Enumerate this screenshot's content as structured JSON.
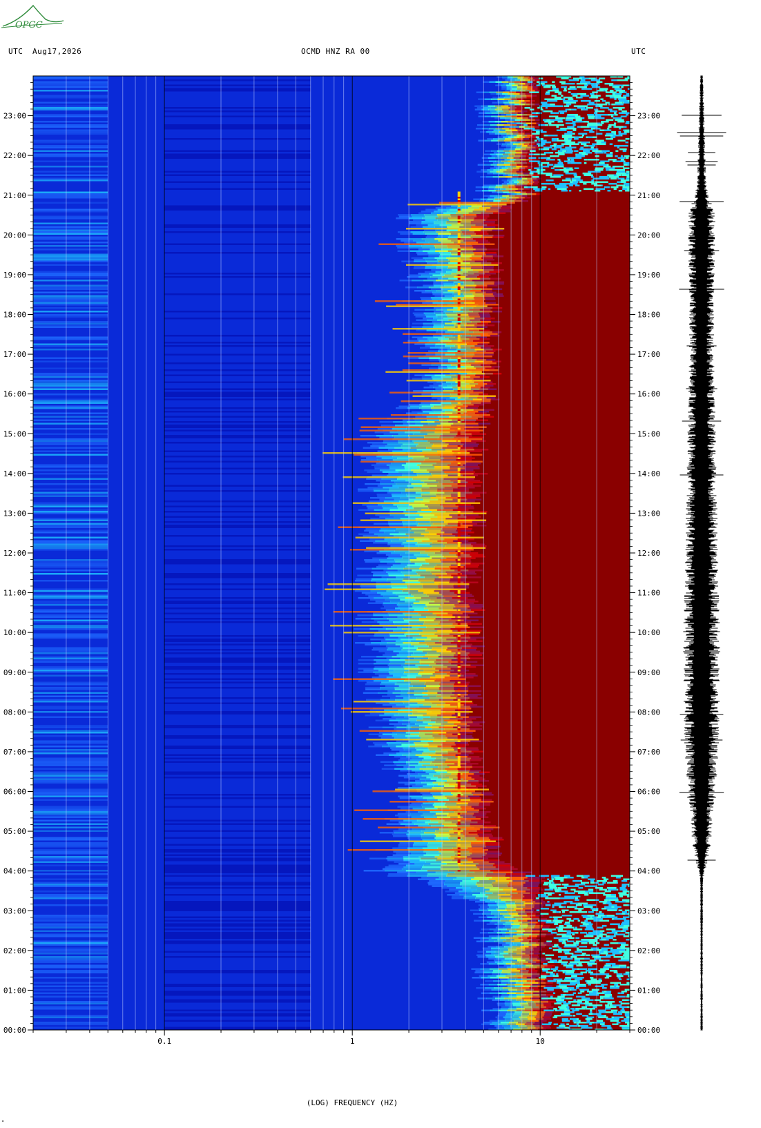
{
  "header": {
    "left_tz": "UTC",
    "date": "Aug17,2026",
    "station": "OCMD HNZ RA 00",
    "right_tz": "UTC"
  },
  "logo": {
    "text": "OPGC",
    "color": "#2e8b3a"
  },
  "footer_mark": "\"",
  "chart_data": {
    "type": "heatmap",
    "title": "OCMD HNZ RA 00",
    "xlabel": "(LOG) FREQUENCY (HZ)",
    "x_scale": "log",
    "xlim": [
      0.02,
      30
    ],
    "x_ticks": [
      {
        "value": 0.1,
        "label": "0.1"
      },
      {
        "value": 1,
        "label": "1"
      },
      {
        "value": 10,
        "label": "10"
      }
    ],
    "y_labels": [
      "00:00",
      "01:00",
      "02:00",
      "03:00",
      "04:00",
      "05:00",
      "06:00",
      "07:00",
      "08:00",
      "09:00",
      "10:00",
      "11:00",
      "12:00",
      "13:00",
      "14:00",
      "15:00",
      "16:00",
      "17:00",
      "18:00",
      "19:00",
      "20:00",
      "21:00",
      "22:00",
      "23:00"
    ],
    "ylim_hours": [
      0,
      24
    ],
    "colormap": [
      "#0000a0",
      "#0a2ad8",
      "#1f6bff",
      "#1fc0ff",
      "#40ffe0",
      "#c8ff40",
      "#ffd000",
      "#ff6000",
      "#d00000",
      "#8a0000"
    ],
    "noise_edge_hz": [
      {
        "hour": 0,
        "hz": 5.5
      },
      {
        "hour": 3,
        "hz": 5.0
      },
      {
        "hour": 4,
        "hz": 1.4
      },
      {
        "hour": 6,
        "hz": 2.0
      },
      {
        "hour": 7,
        "hz": 1.5
      },
      {
        "hour": 10,
        "hz": 1.2
      },
      {
        "hour": 12,
        "hz": 1.3
      },
      {
        "hour": 15,
        "hz": 1.3
      },
      {
        "hour": 16,
        "hz": 2.5
      },
      {
        "hour": 20.6,
        "hz": 2.0
      },
      {
        "hour": 21,
        "hz": 5.5
      },
      {
        "hour": 24,
        "hz": 5.5
      }
    ],
    "saturated_edge_hz": [
      {
        "hour": 0,
        "hz": 11
      },
      {
        "hour": 3.8,
        "hz": 10
      },
      {
        "hour": 4.2,
        "hz": 6.0
      },
      {
        "hour": 7,
        "hz": 4.5
      },
      {
        "hour": 11,
        "hz": 4.5
      },
      {
        "hour": 15,
        "hz": 4.8
      },
      {
        "hour": 16,
        "hz": 5.5
      },
      {
        "hour": 20.5,
        "hz": 5.8
      },
      {
        "hour": 21,
        "hz": 9.0
      },
      {
        "hour": 24,
        "hz": 9.0
      }
    ],
    "active_period_hours": [
      3.9,
      21.1
    ],
    "tremor_line_hz": 3.7,
    "waveform": {
      "label": "seismogram trace",
      "amplitude_profile": [
        {
          "hour": 0,
          "amp": 0.05
        },
        {
          "hour": 3.8,
          "amp": 0.06
        },
        {
          "hour": 4.5,
          "amp": 0.35
        },
        {
          "hour": 7,
          "amp": 0.7
        },
        {
          "hour": 10,
          "amp": 0.75
        },
        {
          "hour": 14,
          "amp": 0.6
        },
        {
          "hour": 17,
          "amp": 0.5
        },
        {
          "hour": 20.5,
          "amp": 0.55
        },
        {
          "hour": 21.2,
          "amp": 0.2
        },
        {
          "hour": 24,
          "amp": 0.06
        }
      ]
    }
  }
}
